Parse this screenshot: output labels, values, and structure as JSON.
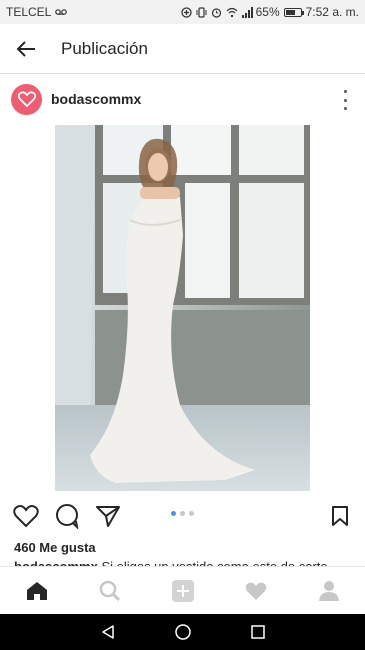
{
  "status_bar": {
    "carrier": "TELCEL",
    "battery": "65%",
    "battery_level": 0.65,
    "time": "7:52 a. m."
  },
  "app_bar": {
    "title": "Publicación",
    "back_icon": "arrow-back-icon"
  },
  "post": {
    "username": "bodascommx",
    "avatar_icon": "heart-logo-icon",
    "avatar_color": "#ef5e70",
    "more_icon": "more-vertical-icon",
    "likes": "460 Me gusta",
    "caption_user": "bodascommx",
    "caption_text": "Si eliges un vestido como este de corte",
    "carousel": {
      "count": 3,
      "active": 1
    }
  },
  "actions": {
    "like_icon": "heart-outline-icon",
    "comment_icon": "comment-icon",
    "share_icon": "send-icon",
    "save_icon": "bookmark-icon"
  },
  "bottom_nav": {
    "items": [
      "home-icon",
      "search-icon",
      "add-icon",
      "activity-heart-icon",
      "profile-icon"
    ],
    "active": "home-icon"
  },
  "system_nav": {
    "items": [
      "back-triangle-icon",
      "home-circle-icon",
      "recents-square-icon"
    ]
  },
  "colors": {
    "accent_blue": "#3897f0",
    "text": "#262626",
    "divider": "#dbdbdb"
  }
}
